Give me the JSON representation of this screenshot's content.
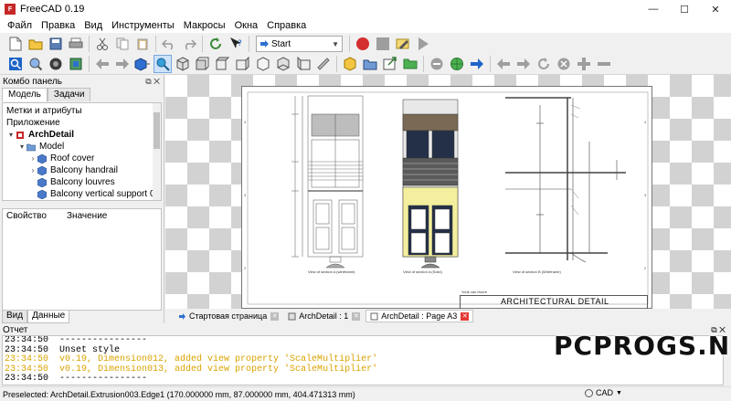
{
  "window": {
    "title": "FreeCAD 0.19",
    "min": "—",
    "max": "☐",
    "close": "✕"
  },
  "menu": [
    "Файл",
    "Правка",
    "Вид",
    "Инструменты",
    "Макросы",
    "Окна",
    "Справка"
  ],
  "toolbar": {
    "workbench": "Start"
  },
  "combo": {
    "title": "Комбо панель",
    "tabs": [
      "Модель",
      "Задачи"
    ],
    "labels_section": "Метки и атрибуты",
    "app_section": "Приложение",
    "tree": [
      {
        "label": "ArchDetail",
        "level": 0,
        "arrow": "▾",
        "bold": true
      },
      {
        "label": "Model",
        "level": 1,
        "arrow": "▾"
      },
      {
        "label": "Roof cover",
        "level": 2,
        "arrow": "›"
      },
      {
        "label": "Balcony handrail",
        "level": 2,
        "arrow": "›"
      },
      {
        "label": "Balcony louvres",
        "level": 2,
        "arrow": ""
      },
      {
        "label": "Balcony vertical support 02",
        "level": 2,
        "arrow": ""
      }
    ],
    "prop_col1": "Свойство",
    "prop_col2": "Значение",
    "view_tabs": [
      "Вид",
      "Данные"
    ]
  },
  "drawing": {
    "view_labels": [
      "View of section A (wireframe)",
      "View of section A (Solid)",
      "View of section B (Wireframe)"
    ],
    "title_block": "ARCHITECTURAL DETAIL",
    "author": "Yorik van Havre"
  },
  "doc_tabs": [
    {
      "label": "Стартовая страница",
      "active": false
    },
    {
      "label": "ArchDetail : 1",
      "active": false
    },
    {
      "label": "ArchDetail : Page A3",
      "active": true
    }
  ],
  "report": {
    "title": "Отчет",
    "lines": [
      {
        "time": "23:34:50",
        "text": "----------------",
        "warn": false
      },
      {
        "time": "23:34:50",
        "text": "Unset style",
        "warn": false
      },
      {
        "time": "23:34:50",
        "text": "v0.19, Dimension012, added view property 'ScaleMultiplier'",
        "warn": true
      },
      {
        "time": "23:34:50",
        "text": "v0.19, Dimension013, added view property 'ScaleMultiplier'",
        "warn": true
      },
      {
        "time": "23:34:50",
        "text": "----------------",
        "warn": false
      }
    ]
  },
  "status": {
    "text": "Preselected: ArchDetail.Extrusion003.Edge1 (170.000000 mm, 87.000000 mm, 404.471313 mm)",
    "nav": "CAD"
  },
  "watermark": "PCPROGS.NET",
  "colors": {
    "record": "#d32f2f",
    "accent": "#1e64c8",
    "warn": "#d9a300"
  }
}
